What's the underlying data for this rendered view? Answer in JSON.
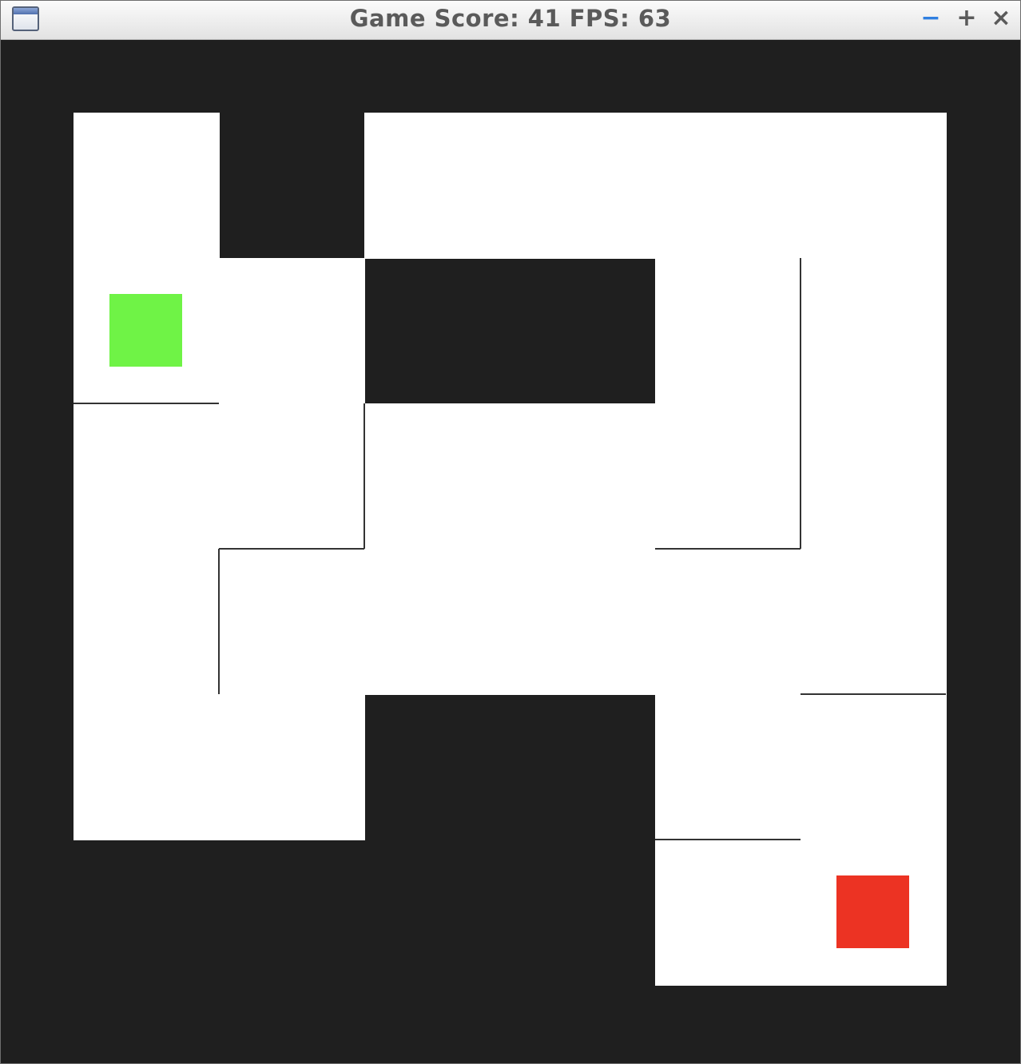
{
  "window": {
    "title": "Game Score: 41 FPS: 63",
    "controls": {
      "minimize": "−",
      "maximize": "+",
      "close": "×"
    }
  },
  "game": {
    "score": 41,
    "fps": 63,
    "grid": {
      "columns": 6,
      "rows": 6
    },
    "colors": {
      "background": "#1f1f1f",
      "floor": "#ffffff",
      "wall": "#333333",
      "player": "#6ff346",
      "goal": "#ec3323"
    },
    "floor_cells": [
      [
        0,
        0
      ],
      [
        0,
        1
      ],
      [
        0,
        2
      ],
      [
        0,
        3
      ],
      [
        0,
        4
      ],
      [
        1,
        1
      ],
      [
        1,
        2
      ],
      [
        1,
        3
      ],
      [
        1,
        4
      ],
      [
        2,
        0
      ],
      [
        2,
        2
      ],
      [
        2,
        3
      ],
      [
        3,
        0
      ],
      [
        3,
        2
      ],
      [
        3,
        3
      ],
      [
        4,
        0
      ],
      [
        4,
        1
      ],
      [
        4,
        2
      ],
      [
        4,
        3
      ],
      [
        4,
        4
      ],
      [
        4,
        5
      ],
      [
        5,
        0
      ],
      [
        5,
        1
      ],
      [
        5,
        2
      ],
      [
        5,
        3
      ],
      [
        5,
        4
      ],
      [
        5,
        5
      ]
    ],
    "walls": [
      {
        "axis": "h",
        "row": 2,
        "from_col": 0,
        "to_col": 1
      },
      {
        "axis": "v",
        "col": 2,
        "from_row": 2,
        "to_row": 3
      },
      {
        "axis": "h",
        "row": 3,
        "from_col": 1,
        "to_col": 2
      },
      {
        "axis": "v",
        "col": 1,
        "from_row": 3,
        "to_row": 4
      },
      {
        "axis": "v",
        "col": 5,
        "from_row": 1,
        "to_row": 3
      },
      {
        "axis": "h",
        "row": 3,
        "from_col": 4,
        "to_col": 5
      },
      {
        "axis": "h",
        "row": 4,
        "from_col": 5,
        "to_col": 6
      },
      {
        "axis": "h",
        "row": 5,
        "from_col": 4,
        "to_col": 5
      }
    ],
    "player": {
      "col": 0,
      "row": 1
    },
    "goal": {
      "col": 5,
      "row": 5
    }
  }
}
